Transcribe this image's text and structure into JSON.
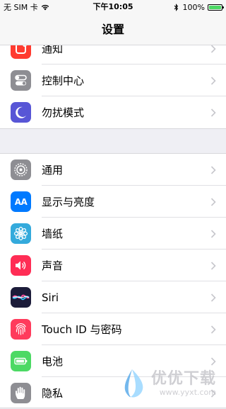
{
  "status_bar": {
    "carrier": "无 SIM 卡",
    "time": "下午10:05",
    "battery_percent": "100%",
    "battery_level": 1.0
  },
  "nav": {
    "title": "设置"
  },
  "groups": [
    {
      "items": [
        {
          "label": "通知",
          "icon": "notifications-icon",
          "color": "#ff3b30"
        },
        {
          "label": "控制中心",
          "icon": "control-center-icon",
          "color": "#8e8e93"
        },
        {
          "label": "勿扰模式",
          "icon": "moon-icon",
          "color": "#5856d6"
        }
      ]
    },
    {
      "items": [
        {
          "label": "通用",
          "icon": "gear-icon",
          "color": "#8e8e93"
        },
        {
          "label": "显示与亮度",
          "icon": "display-brightness-icon",
          "color": "#007aff"
        },
        {
          "label": "墙纸",
          "icon": "wallpaper-icon",
          "color": "#34aadc"
        },
        {
          "label": "声音",
          "icon": "speaker-icon",
          "color": "#ff2d55"
        },
        {
          "label": "Siri",
          "icon": "siri-icon",
          "color": "#1c1c3a"
        },
        {
          "label": "Touch ID 与密码",
          "icon": "fingerprint-icon",
          "color": "#ff3b5c"
        },
        {
          "label": "电池",
          "icon": "battery-icon",
          "color": "#4cd964"
        },
        {
          "label": "隐私",
          "icon": "hand-icon",
          "color": "#8e8e93"
        }
      ]
    }
  ],
  "icon_glyphs": {
    "display_brightness": "AA"
  },
  "watermark": {
    "title": "优优下载",
    "url": "www.yyxt.com"
  }
}
